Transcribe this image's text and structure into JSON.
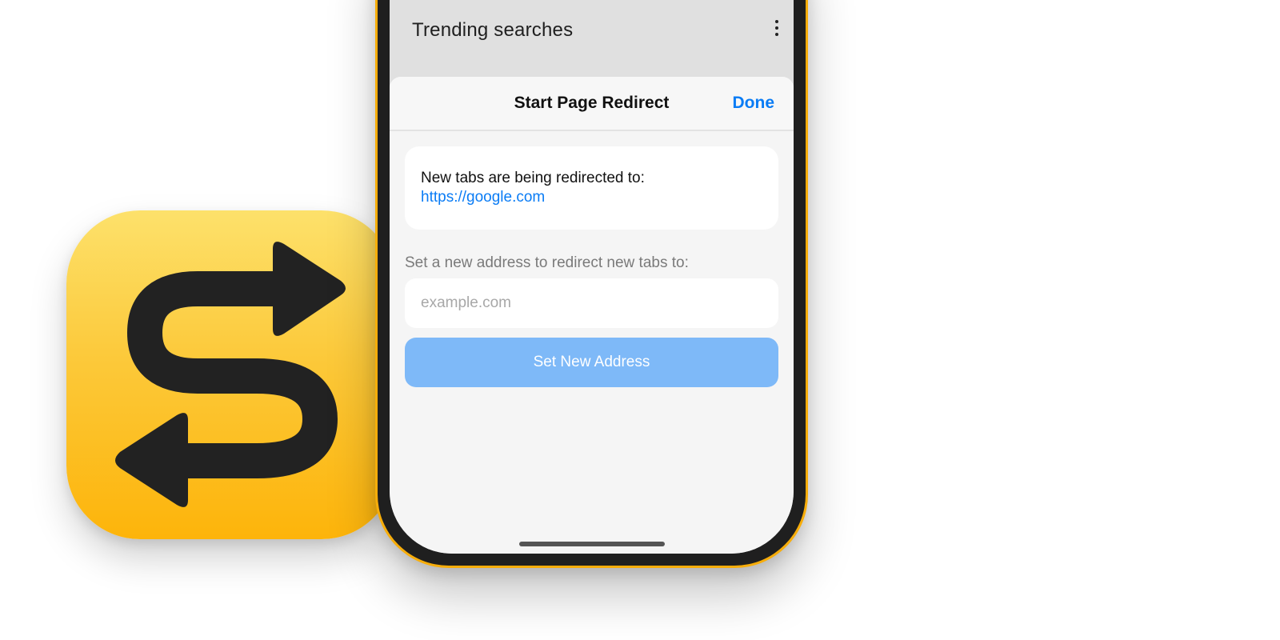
{
  "background_page": {
    "trending_title": "Trending searches",
    "more_icon": "vertical-ellipsis-icon"
  },
  "sheet": {
    "title": "Start Page Redirect",
    "done_label": "Done",
    "info_text": "New tabs are being redirected to:",
    "current_url": "https://google.com",
    "section_label": "Set a new address to redirect new tabs to:",
    "input_placeholder": "example.com",
    "input_value": "",
    "set_button_label": "Set New Address"
  },
  "app_icon": {
    "icon": "redirect-s-arrows-icon"
  },
  "colors": {
    "accent": "#0A7CF5",
    "button_disabled": "#7EB9F8",
    "icon_yellow_top": "#FDE16B",
    "icon_yellow_bottom": "#FDB40A",
    "glyph": "#222222",
    "phone_frame_outline": "#F7AD0A"
  }
}
